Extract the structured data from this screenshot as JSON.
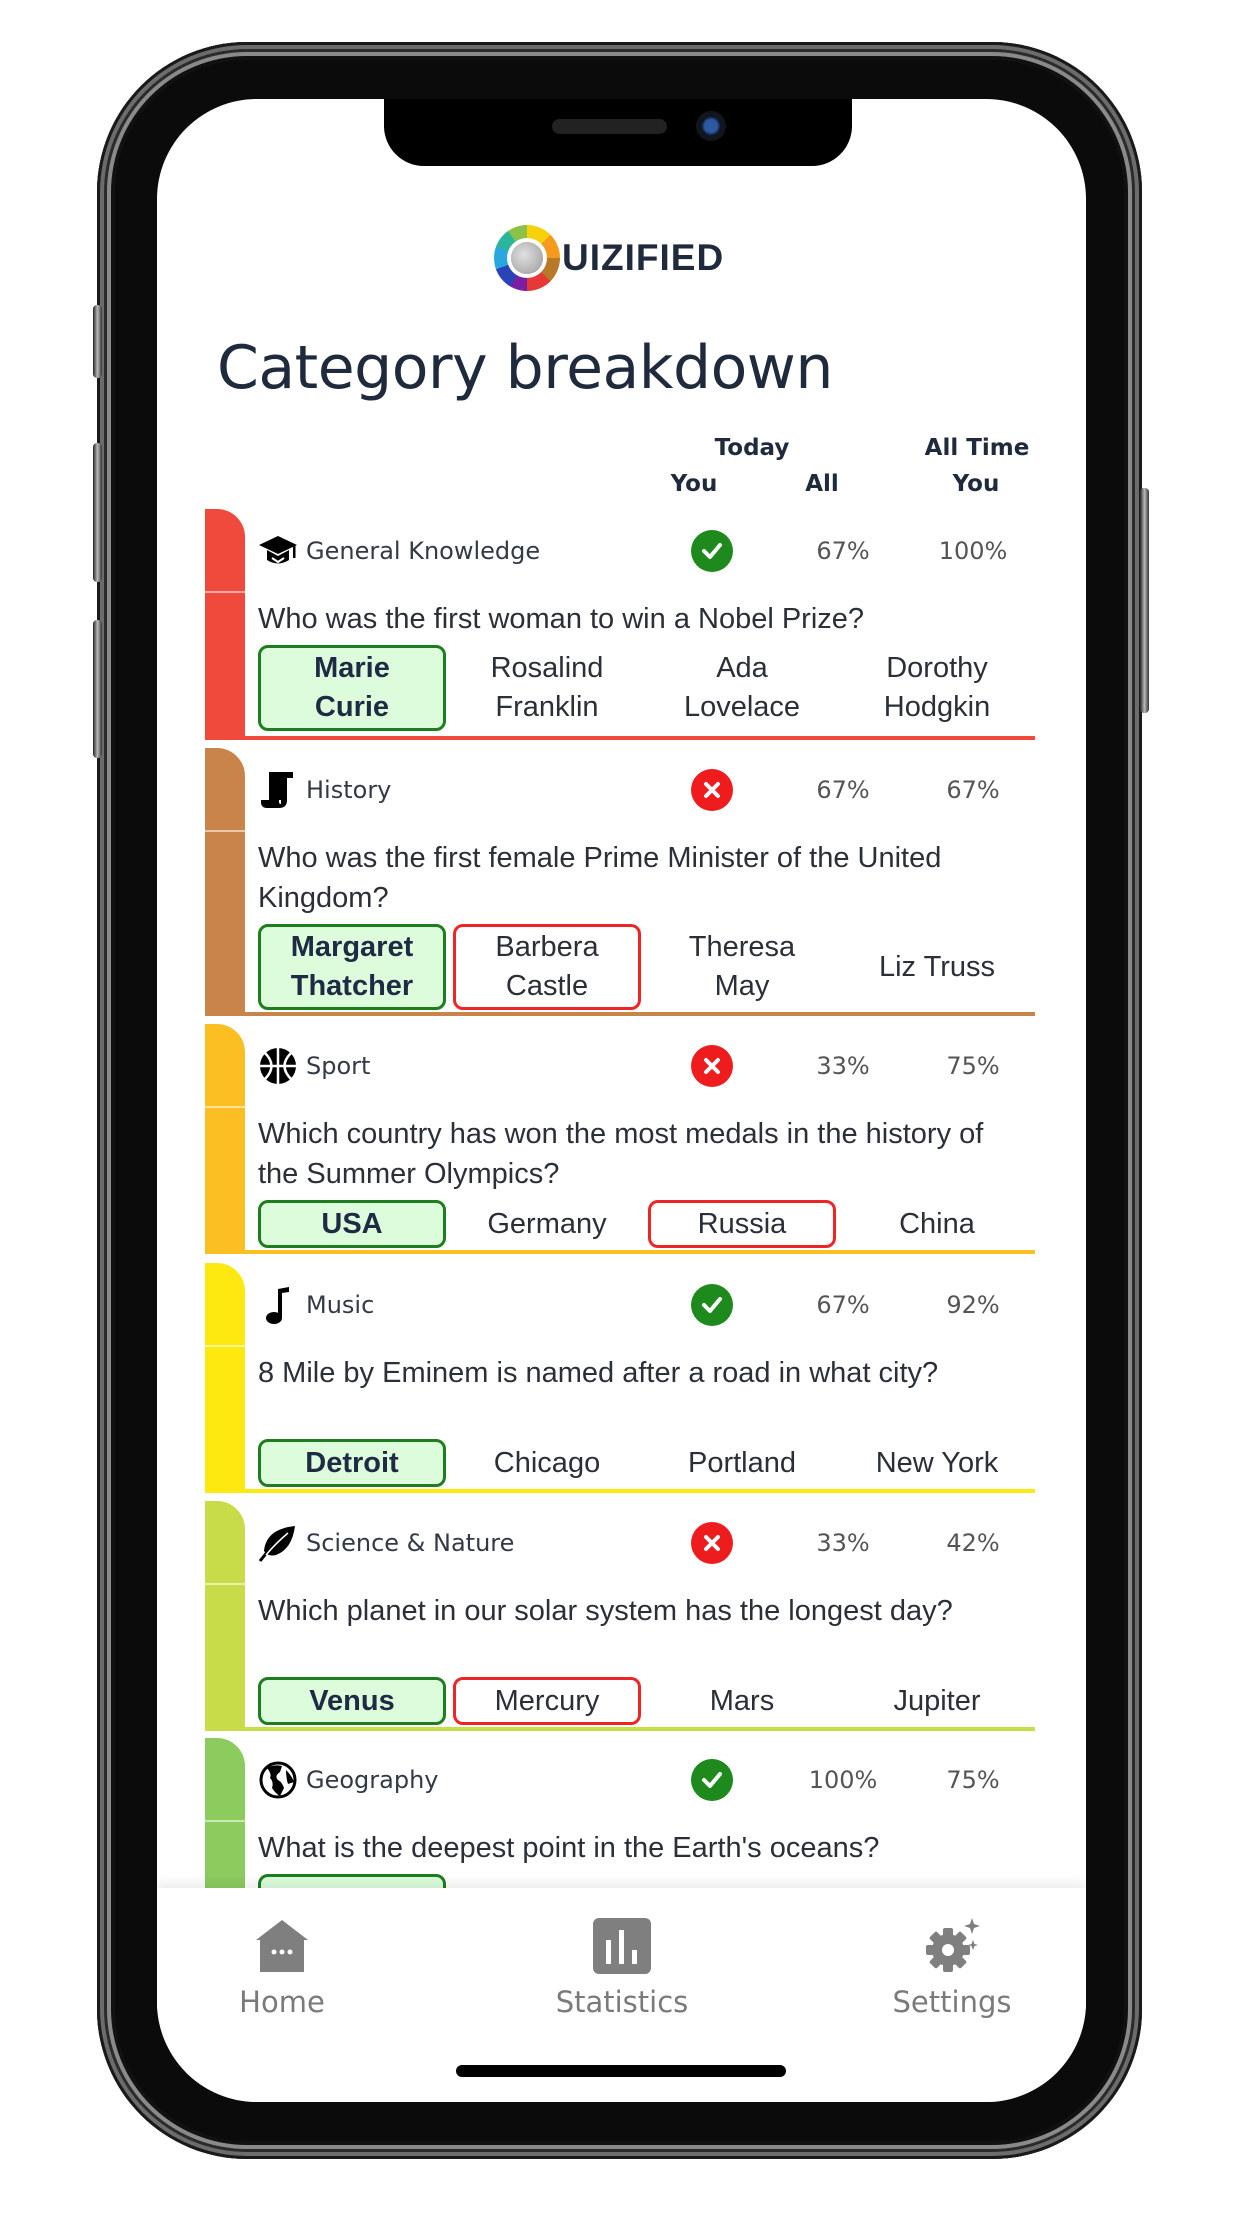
{
  "app": {
    "logo_text": "UIZIFIED",
    "logo_letter": "Q"
  },
  "page_title": "Category breakdown",
  "columns": {
    "today": "Today",
    "all_time": "All Time",
    "you": "You",
    "all": "All",
    "all_time_you": "You"
  },
  "colors": {
    "correct": "#1e8a1e",
    "wrong": "#ee1c1c",
    "correct_fill": "#dcfcdc"
  },
  "categories": [
    {
      "name": "General Knowledge",
      "icon": "graduation-cap-icon",
      "color": "#ef4a3c",
      "today_you": "correct",
      "today_all": "67%",
      "all_time_you": "100%",
      "question": "Who was the first woman to win a Nobel Prize?",
      "answers": [
        {
          "label": "Marie\nCurie",
          "state": "correct"
        },
        {
          "label": "Rosalind\nFranklin",
          "state": "none"
        },
        {
          "label": "Ada\nLovelace",
          "state": "none"
        },
        {
          "label": "Dorothy\nHodgkin",
          "state": "none"
        }
      ]
    },
    {
      "name": "History",
      "icon": "scroll-icon",
      "color": "#c9844a",
      "today_you": "wrong",
      "today_all": "67%",
      "all_time_you": "67%",
      "question": "Who was the first female Prime Minister of the United Kingdom?",
      "answers": [
        {
          "label": "Margaret\nThatcher",
          "state": "correct"
        },
        {
          "label": "Barbera\nCastle",
          "state": "wrong"
        },
        {
          "label": "Theresa\nMay",
          "state": "none"
        },
        {
          "label": "Liz Truss",
          "state": "none"
        }
      ]
    },
    {
      "name": "Sport",
      "icon": "basketball-icon",
      "color": "#fbbf24",
      "today_you": "wrong",
      "today_all": "33%",
      "all_time_you": "75%",
      "question": "Which country has won the most medals in the history of the Summer Olympics?",
      "answers": [
        {
          "label": "USA",
          "state": "correct"
        },
        {
          "label": "Germany",
          "state": "none"
        },
        {
          "label": "Russia",
          "state": "wrong"
        },
        {
          "label": "China",
          "state": "none"
        }
      ]
    },
    {
      "name": "Music",
      "icon": "music-note-icon",
      "color": "#fde910",
      "today_you": "correct",
      "today_all": "67%",
      "all_time_you": "92%",
      "question": "8 Mile by Eminem is named after a road in what city?",
      "answers": [
        {
          "label": "Detroit",
          "state": "correct"
        },
        {
          "label": "Chicago",
          "state": "none"
        },
        {
          "label": "Portland",
          "state": "none"
        },
        {
          "label": "New York",
          "state": "none"
        }
      ]
    },
    {
      "name": "Science & Nature",
      "icon": "leaf-icon",
      "color": "#c8dc4a",
      "today_you": "wrong",
      "today_all": "33%",
      "all_time_you": "42%",
      "question": "Which planet in our solar system has the longest day?",
      "answers": [
        {
          "label": "Venus",
          "state": "correct"
        },
        {
          "label": "Mercury",
          "state": "wrong"
        },
        {
          "label": "Mars",
          "state": "none"
        },
        {
          "label": "Jupiter",
          "state": "none"
        }
      ]
    },
    {
      "name": "Geography",
      "icon": "globe-icon",
      "color": "#8ccb5e",
      "today_you": "correct",
      "today_all": "100%",
      "all_time_you": "75%",
      "question": "What is the deepest point in the Earth's oceans?",
      "answers": []
    }
  ],
  "nav": [
    {
      "label": "Home",
      "icon": "home-icon"
    },
    {
      "label": "Statistics",
      "icon": "statistics-icon"
    },
    {
      "label": "Settings",
      "icon": "settings-icon"
    }
  ]
}
